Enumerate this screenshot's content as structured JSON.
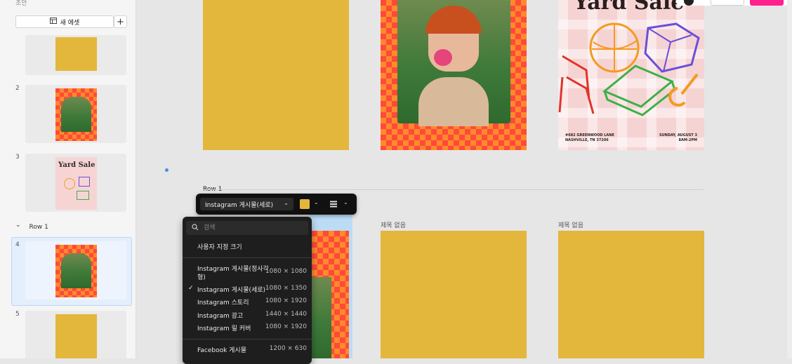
{
  "sidebar": {
    "top_label": "초안",
    "new_asset_label": "새 에셋",
    "add_label": "+",
    "thumbs": [
      {
        "num": ""
      },
      {
        "num": "2"
      },
      {
        "num": "3"
      },
      {
        "num": "4"
      },
      {
        "num": "5"
      }
    ],
    "row_label": "Row 1",
    "row_chevron": "⌄"
  },
  "canvas": {
    "row_title": "Row 1",
    "frame_label_untitled": "제목 없음",
    "frame_label_untitled2": "제목 없음",
    "yard_sale_title": "Yard Sale",
    "yard_sale_left": "#682 GREENWOOD LANE\nNASHVILLE, TN 37206",
    "yard_sale_right": "SUNDAY, AUGUST 3\n8AM-2PM"
  },
  "toolbar": {
    "size_select": "Instagram 게시물(세로)",
    "chevron": "⌄",
    "swatch_color": "#e3b73c"
  },
  "dropdown": {
    "search_placeholder": "검색",
    "custom_size": "사용자 지정 크기",
    "items": [
      {
        "label": "Instagram 게시물(정사각",
        "label2": "형)",
        "dim": "1080 × 1080",
        "checked": false
      },
      {
        "label": "Instagram 게시물(세로)",
        "dim": "1080 × 1350",
        "checked": true
      },
      {
        "label": "Instagram 스토리",
        "dim": "1080 × 1920",
        "checked": false
      },
      {
        "label": "Instagram 광고",
        "dim": "1440 × 1440",
        "checked": false
      },
      {
        "label": "Instagram 릴 커버",
        "dim": "1080 × 1920",
        "checked": false
      }
    ],
    "facebook": {
      "label": "Facebook 게시물",
      "dim": "1200 × 630"
    },
    "check_glyph": "✓"
  },
  "colors": {
    "mustard": "#e3b73c",
    "accent_pink": "#ff1f8e",
    "selection_blue": "#4a90e2"
  },
  "icons": [
    "layout-icon",
    "search-icon",
    "check-icon",
    "chevron-down-icon",
    "plus-icon"
  ]
}
